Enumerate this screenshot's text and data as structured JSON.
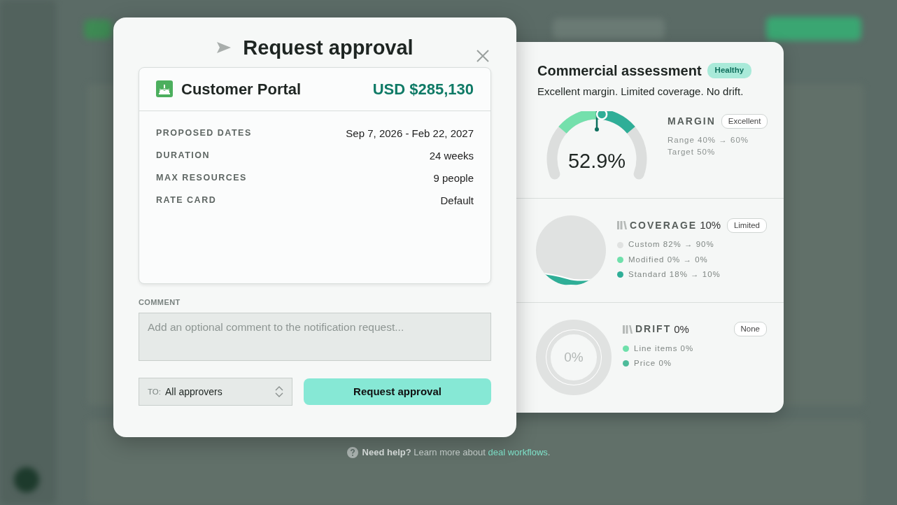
{
  "dialog": {
    "title": "Request approval",
    "deal": {
      "name": "Customer Portal",
      "amount": "USD $285,130"
    },
    "details": [
      {
        "label": "PROPOSED DATES",
        "value": "Sep 7, 2026 - Feb 22, 2027"
      },
      {
        "label": "DURATION",
        "value": "24 weeks"
      },
      {
        "label": "MAX RESOURCES",
        "value": "9 people"
      },
      {
        "label": "RATE CARD",
        "value": "Default"
      }
    ],
    "comment": {
      "label": "COMMENT",
      "placeholder": "Add an optional comment to the notification request..."
    },
    "recipient": {
      "prefix": "TO:",
      "value": "All approvers"
    },
    "submit": "Request approval"
  },
  "assessment": {
    "title": "Commercial assessment",
    "status": "Healthy",
    "summary": "Excellent margin. Limited coverage. No drift.",
    "margin": {
      "label": "MARGIN",
      "badge": "Excellent",
      "value": "52.9%",
      "level": 0.529,
      "range": "Range 40% → 60%",
      "target": "Target 50%"
    },
    "coverage": {
      "label": "COVERAGE",
      "value": "10%",
      "badge": "Limited",
      "legend": [
        {
          "text": "Custom 82% → 90%",
          "color": "#e0e2e1"
        },
        {
          "text": "Modified 0% → 0%",
          "color": "#6fe0ab"
        },
        {
          "text": "Standard 18% → 10%",
          "color": "#2fae97"
        }
      ]
    },
    "drift": {
      "label": "DRIFT",
      "value": "0%",
      "center": "0%",
      "badge": "None",
      "legend": [
        {
          "text": "Line items 0%",
          "color": "#6fe0ab"
        },
        {
          "text": "Price 0%",
          "color": "#4dbb9a"
        }
      ]
    }
  },
  "help": {
    "lead": "**Need help?** Learn more about",
    "link": "deal workflows",
    "end": "."
  }
}
